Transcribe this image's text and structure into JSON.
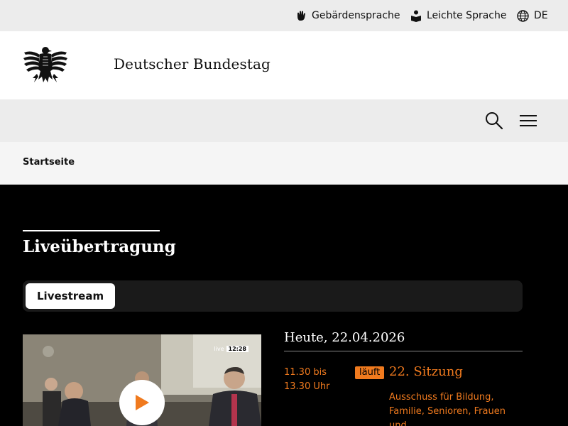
{
  "utility": {
    "sign_language": "Gebärdensprache",
    "easy_language": "Leichte Sprache",
    "language": "DE"
  },
  "header": {
    "title": "Deutscher Bundestag",
    "logo_icon": "federal-eagle-icon"
  },
  "nav": {
    "search_icon": "search-icon",
    "menu_icon": "hamburger-menu-icon"
  },
  "breadcrumb": {
    "home": "Startseite"
  },
  "main": {
    "section_title": "Liveübertragung",
    "tabs": [
      {
        "label": "Livestream",
        "active": true
      }
    ],
    "video": {
      "live_label": "live",
      "time": "12:28"
    },
    "schedule": {
      "date_heading": "Heute, 22.04.2026",
      "sessions": [
        {
          "time_start": "11.30 bis",
          "time_end": "13.30 Uhr",
          "status": "läuft",
          "title": "22. Sitzung",
          "description": "Ausschuss für Bildung, Familie, Senioren, Frauen und"
        }
      ]
    }
  },
  "colors": {
    "accent": "#f07a1e",
    "background_dark": "#000000",
    "utility_bg": "#ececec"
  }
}
